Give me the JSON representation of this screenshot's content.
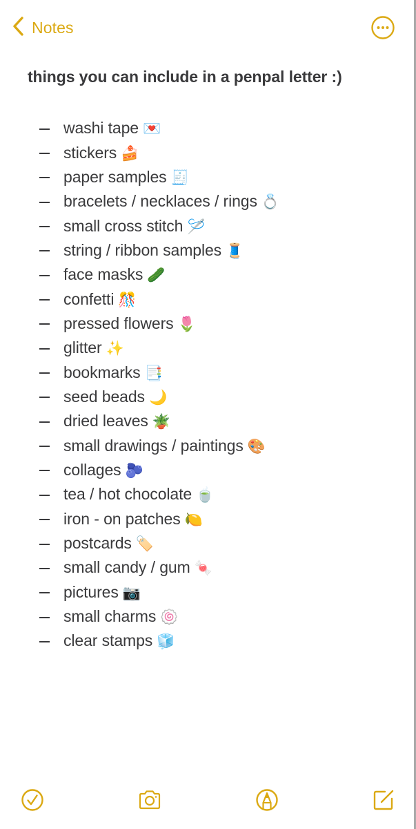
{
  "app": "Notes",
  "theme": {
    "accent": "#DBA913",
    "text": "#3a3a3c"
  },
  "nav": {
    "back_label": "Notes",
    "back_icon": "chevron-left-icon",
    "more_icon": "ellipsis-circle-icon"
  },
  "note": {
    "title": "things you can include in a penpal letter :)",
    "bullet": "–",
    "items": [
      {
        "text": "washi tape",
        "emoji": "💌"
      },
      {
        "text": "stickers",
        "emoji": "🍰"
      },
      {
        "text": "paper samples",
        "emoji": "🧾"
      },
      {
        "text": "bracelets / necklaces / rings",
        "emoji": "💍"
      },
      {
        "text": "small cross stitch",
        "emoji": "🪡"
      },
      {
        "text": "string / ribbon samples",
        "emoji": "🧵"
      },
      {
        "text": "face masks",
        "emoji": "🥒"
      },
      {
        "text": "confetti",
        "emoji": "🎊"
      },
      {
        "text": "pressed flowers",
        "emoji": "🌷"
      },
      {
        "text": "glitter",
        "emoji": "✨"
      },
      {
        "text": "bookmarks",
        "emoji": "📑"
      },
      {
        "text": "seed beads",
        "emoji": "🌙"
      },
      {
        "text": "dried leaves",
        "emoji": "🪴"
      },
      {
        "text": "small drawings / paintings",
        "emoji": "🎨"
      },
      {
        "text": "collages",
        "emoji": "🫐"
      },
      {
        "text": "tea / hot chocolate",
        "emoji": "🍵"
      },
      {
        "text": "iron - on patches",
        "emoji": "🍋"
      },
      {
        "text": "postcards",
        "emoji": "🏷️"
      },
      {
        "text": "small candy / gum",
        "emoji": "🍬"
      },
      {
        "text": "pictures",
        "emoji": "📷"
      },
      {
        "text": "small charms",
        "emoji": "🍥"
      },
      {
        "text": "clear stamps",
        "emoji": "🧊"
      }
    ]
  },
  "toolbar": {
    "buttons": [
      {
        "name": "checklist-button",
        "icon": "checkmark-circle-icon"
      },
      {
        "name": "camera-button",
        "icon": "camera-icon"
      },
      {
        "name": "markup-button",
        "icon": "pen-tip-circle-icon"
      },
      {
        "name": "compose-button",
        "icon": "compose-icon"
      }
    ]
  }
}
